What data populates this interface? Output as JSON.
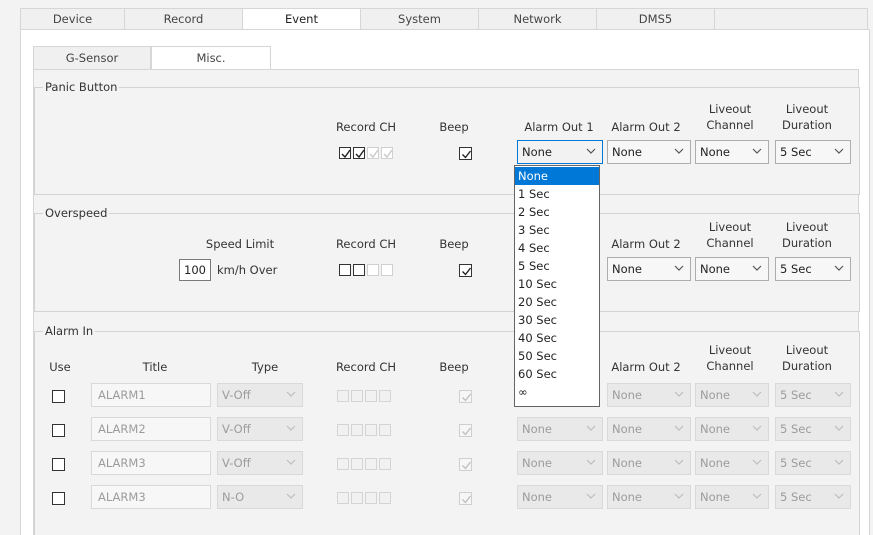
{
  "top_tabs": [
    "Device",
    "Record",
    "Event",
    "System",
    "Network",
    "DMS5"
  ],
  "sub_tabs": [
    "G-Sensor",
    "Misc."
  ],
  "panic": {
    "title": "Panic Button",
    "col_record_ch": "Record CH",
    "col_beep": "Beep",
    "col_alarm_out_1": "Alarm Out 1",
    "col_alarm_out_2": "Alarm Out 2",
    "col_liveout_channel_1": "Liveout",
    "col_liveout_channel_2": "Channel",
    "col_liveout_duration_1": "Liveout",
    "col_liveout_duration_2": "Duration",
    "alarm_out_1": "None",
    "alarm_out_2": "None",
    "liveout_channel": "None",
    "liveout_duration": "5 Sec"
  },
  "overspeed": {
    "title": "Overspeed",
    "col_speed_limit": "Speed Limit",
    "speed_value": "100",
    "speed_unit": "km/h Over",
    "col_record_ch": "Record CH",
    "col_beep": "Beep",
    "col_alarm_out_2": "Alarm Out 2",
    "col_liveout_channel_1": "Liveout",
    "col_liveout_channel_2": "Channel",
    "col_liveout_duration_1": "Liveout",
    "col_liveout_duration_2": "Duration",
    "alarm_out_2": "None",
    "liveout_channel": "None",
    "liveout_duration": "5 Sec"
  },
  "alarm_in": {
    "title": "Alarm In",
    "col_use": "Use",
    "col_title": "Title",
    "col_type": "Type",
    "col_record_ch": "Record CH",
    "col_beep": "Beep",
    "col_alarm_out_2": "Alarm Out 2",
    "col_liveout_channel_1": "Liveout",
    "col_liveout_channel_2": "Channel",
    "col_liveout_duration_1": "Liveout",
    "col_liveout_duration_2": "Duration",
    "rows": [
      {
        "title": "ALARM1",
        "type": "V-Off",
        "alarm_out_1": "",
        "alarm_out_2": "None",
        "liveout_channel": "None",
        "liveout_duration": "5 Sec"
      },
      {
        "title": "ALARM2",
        "type": "V-Off",
        "alarm_out_1": "None",
        "alarm_out_2": "None",
        "liveout_channel": "None",
        "liveout_duration": "5 Sec"
      },
      {
        "title": "ALARM3",
        "type": "V-Off",
        "alarm_out_1": "None",
        "alarm_out_2": "None",
        "liveout_channel": "None",
        "liveout_duration": "5 Sec"
      },
      {
        "title": "ALARM3",
        "type": "N-O",
        "alarm_out_1": "None",
        "alarm_out_2": "None",
        "liveout_channel": "None",
        "liveout_duration": "5 Sec"
      }
    ]
  },
  "dropdown_options": [
    "None",
    "1 Sec",
    "2 Sec",
    "3 Sec",
    "4 Sec",
    "5 Sec",
    "10 Sec",
    "20 Sec",
    "30 Sec",
    "40 Sec",
    "50 Sec",
    "60 Sec",
    "∞"
  ],
  "dropdown_selected_index": 0,
  "colors": {
    "accent": "#0078d7",
    "panel": "#f3f3f3",
    "border": "#d6d6d6",
    "disabled_text": "#9c9c9c"
  }
}
